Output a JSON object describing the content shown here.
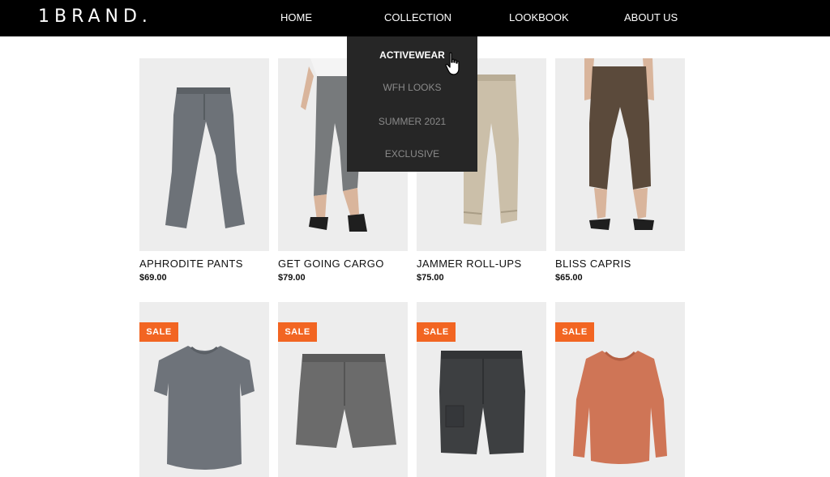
{
  "header": {
    "logo": "1BRAND.",
    "nav": [
      {
        "label": "HOME"
      },
      {
        "label": "COLLECTION"
      },
      {
        "label": "LOOKBOOK"
      },
      {
        "label": "ABOUT US"
      }
    ]
  },
  "dropdown": {
    "items": [
      {
        "label": "ACTIVEWEAR",
        "active": true
      },
      {
        "label": "WFH LOOKS",
        "active": false
      },
      {
        "label": "SUMMER 2021",
        "active": false
      },
      {
        "label": "EXCLUSIVE",
        "active": false
      }
    ]
  },
  "products": [
    {
      "name": "APHRODITE PANTS",
      "price": "$69.00",
      "image": "gray-pants"
    },
    {
      "name": "GET GOING CARGO",
      "price": "$79.00",
      "image": "gray-cropped-pants-model"
    },
    {
      "name": "JAMMER ROLL-UPS",
      "price": "$75.00",
      "image": "beige-rollup-pants"
    },
    {
      "name": "BLISS CAPRIS",
      "price": "$65.00",
      "image": "brown-capris-model"
    },
    {
      "badge": "SALE",
      "image": "gray-tshirt"
    },
    {
      "badge": "SALE",
      "image": "gray-shorts"
    },
    {
      "badge": "SALE",
      "image": "dark-gray-shorts"
    },
    {
      "badge": "SALE",
      "image": "orange-long-sleeve"
    }
  ],
  "colors": {
    "header_bg": "#000000",
    "dropdown_bg": "#262626",
    "sale_badge": "#f26522",
    "card_bg": "#ededed"
  }
}
